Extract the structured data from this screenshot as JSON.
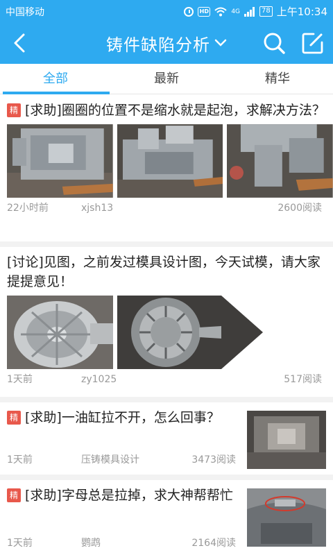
{
  "status_bar": {
    "carrier": "中国移动",
    "network": "4G",
    "battery": "78",
    "time": "上午10:34"
  },
  "header": {
    "title": "铸件缺陷分析",
    "icons": [
      "back-arrow-icon",
      "chevron-down-icon",
      "search-icon",
      "edit-icon"
    ]
  },
  "tabs": [
    {
      "label": "全部",
      "active": true
    },
    {
      "label": "最新",
      "active": false
    },
    {
      "label": "精华",
      "active": false
    }
  ],
  "posts": [
    {
      "badge": "精",
      "title": "[求助]圈圈的位置不是缩水就是起泡，求解决方法？",
      "time": "22小时前",
      "author": "xjsh13",
      "reads": "2600阅读"
    },
    {
      "badge": "",
      "title": "[讨论]见图，之前发过模具设计图，今天试模，请大家提提意见！",
      "time": "1天前",
      "author": "zy1025",
      "reads": "517阅读"
    },
    {
      "badge": "精",
      "title": "[求助]一油缸拉不开，怎么回事？",
      "time": "1天前",
      "author": "压铸模具设计",
      "reads": "3473阅读"
    },
    {
      "badge": "精",
      "title": "[求助]字母总是拉掉，求大神帮帮忙",
      "time": "1天前",
      "author": "鹦鹉",
      "reads": "2164阅读"
    }
  ],
  "colors": {
    "accent": "#2eaaf0",
    "badge": "#e8584b",
    "meta_text": "#999999"
  }
}
